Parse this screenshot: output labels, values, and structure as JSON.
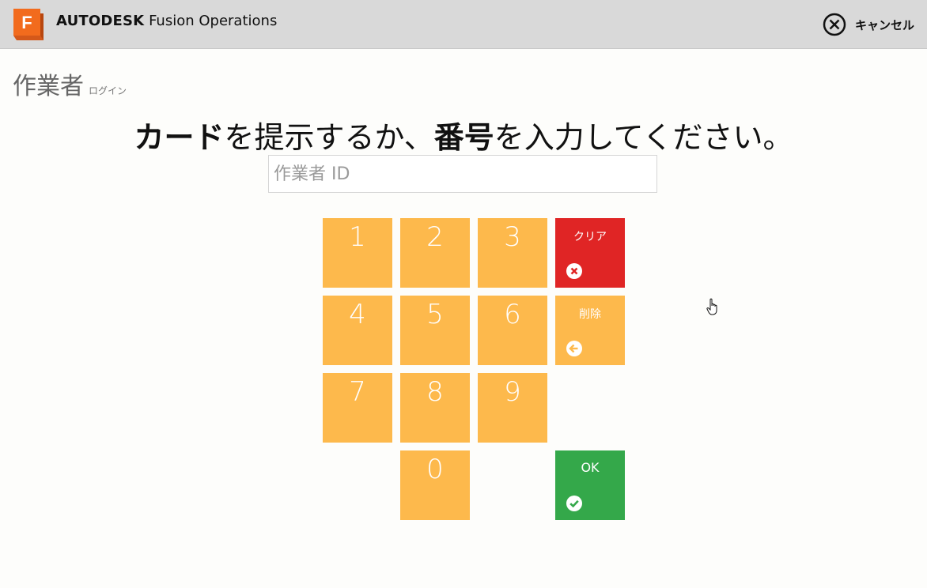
{
  "header": {
    "brand_bold": "AUTODESK",
    "brand_rest": "Fusion Operations",
    "logo_letter": "F",
    "cancel_label": "キャンセル",
    "cancel_icon": "close-circle-icon"
  },
  "page": {
    "title": "作業者",
    "subtitle": "ログイン"
  },
  "instruction": {
    "part1_bold": "カード",
    "part2": "を提示するか、",
    "part3_bold": "番号",
    "part4": "を入力してください。"
  },
  "id_input": {
    "placeholder": "作業者 ID",
    "value": ""
  },
  "keypad": {
    "digits": [
      "1",
      "2",
      "3",
      "4",
      "5",
      "6",
      "7",
      "8",
      "9",
      "0"
    ],
    "clear_label": "クリア",
    "clear_icon": "x-circle-icon",
    "delete_label": "削除",
    "delete_icon": "arrow-left-circle-icon",
    "ok_label": "OK",
    "ok_icon": "check-circle-icon"
  },
  "colors": {
    "key_orange": "#fdb94c",
    "clear_red": "#e02525",
    "ok_green": "#34a84a",
    "logo_orange": "#f26b1d"
  }
}
